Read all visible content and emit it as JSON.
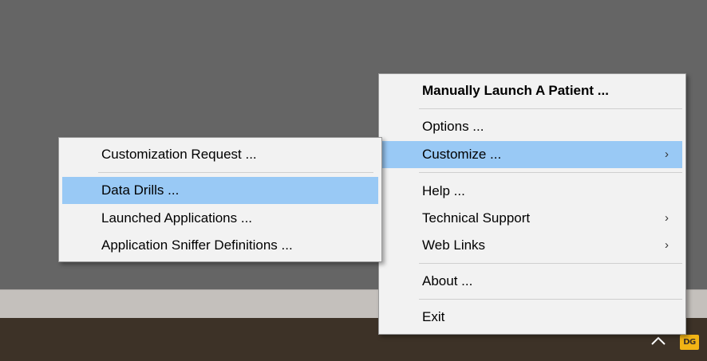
{
  "main_menu": {
    "items": [
      {
        "label": "Manually Launch A Patient ...",
        "bold": true
      },
      {
        "label": "Options ..."
      },
      {
        "label": "Customize ...",
        "submenu_arrow": "›",
        "highlighted": true
      },
      {
        "label": "Help ..."
      },
      {
        "label": "Technical Support",
        "submenu_arrow": "›"
      },
      {
        "label": "Web Links",
        "submenu_arrow": "›"
      },
      {
        "label": "About ..."
      },
      {
        "label": "Exit"
      }
    ]
  },
  "sub_menu": {
    "items": [
      {
        "label": "Customization Request ..."
      },
      {
        "label": "Data Drills ...",
        "highlighted": true
      },
      {
        "label": "Launched Applications ..."
      },
      {
        "label": "Application Sniffer Definitions ..."
      }
    ]
  },
  "tray": {
    "chevron_icon": "chevron-up-icon",
    "app_badge": "DG",
    "app_badge_color": "#f2b415"
  },
  "colors": {
    "highlight": "#99c9f5",
    "menu_background": "#f2f2f2",
    "desktop": "#656565",
    "taskbar": "#3d3227"
  }
}
